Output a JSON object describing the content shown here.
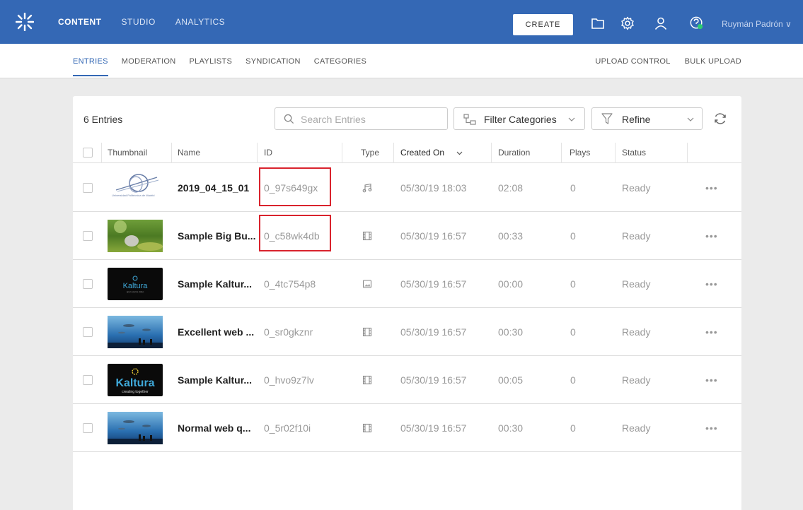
{
  "topbar": {
    "nav": [
      "CONTENT",
      "STUDIO",
      "ANALYTICS"
    ],
    "create_label": "CREATE",
    "user_name": "Ruymán Padrón ∨",
    "color": "#3468b5"
  },
  "subnav": {
    "left": [
      "ENTRIES",
      "MODERATION",
      "PLAYLISTS",
      "SYNDICATION",
      "CATEGORIES"
    ],
    "right": [
      "UPLOAD CONTROL",
      "BULK UPLOAD"
    ]
  },
  "toolbar": {
    "entries_count": "6 Entries",
    "search_placeholder": "Search Entries",
    "filter_categories": "Filter Categories",
    "refine": "Refine"
  },
  "table": {
    "columns": [
      "Thumbnail",
      "Name",
      "ID",
      "Type",
      "Created On",
      "Duration",
      "Plays",
      "Status"
    ],
    "rows": [
      {
        "thumb": "upm-logo",
        "name": "2019_04_15_01",
        "id": "0_97s649gx",
        "type": "audio",
        "created": "05/30/19 18:03",
        "duration": "02:08",
        "plays": "0",
        "status": "Ready"
      },
      {
        "thumb": "big-buck",
        "name": "Sample Big Bu...",
        "id": "0_c58wk4db",
        "type": "video",
        "created": "05/30/19 16:57",
        "duration": "00:33",
        "plays": "0",
        "status": "Ready"
      },
      {
        "thumb": "kaltura-small",
        "name": "Sample Kaltur...",
        "id": "0_4tc754p8",
        "type": "image",
        "created": "05/30/19 16:57",
        "duration": "00:00",
        "plays": "0",
        "status": "Ready"
      },
      {
        "thumb": "aquarium",
        "name": "Excellent web ...",
        "id": "0_sr0gkznr",
        "type": "video",
        "created": "05/30/19 16:57",
        "duration": "00:30",
        "plays": "0",
        "status": "Ready"
      },
      {
        "thumb": "kaltura-large",
        "name": "Sample Kaltur...",
        "id": "0_hvo9z7lv",
        "type": "video",
        "created": "05/30/19 16:57",
        "duration": "00:05",
        "plays": "0",
        "status": "Ready"
      },
      {
        "thumb": "aquarium",
        "name": "Normal web q...",
        "id": "0_5r02f10i",
        "type": "video",
        "created": "05/30/19 16:57",
        "duration": "00:30",
        "plays": "0",
        "status": "Ready"
      }
    ],
    "row_action": "•••"
  },
  "thumbnail_texts": {
    "upm": "Universidad Politécnica de Madrid",
    "kaltura": "Kaltura",
    "kaltura_small_tag": "open source video",
    "kaltura_large_tag": "creating together"
  }
}
